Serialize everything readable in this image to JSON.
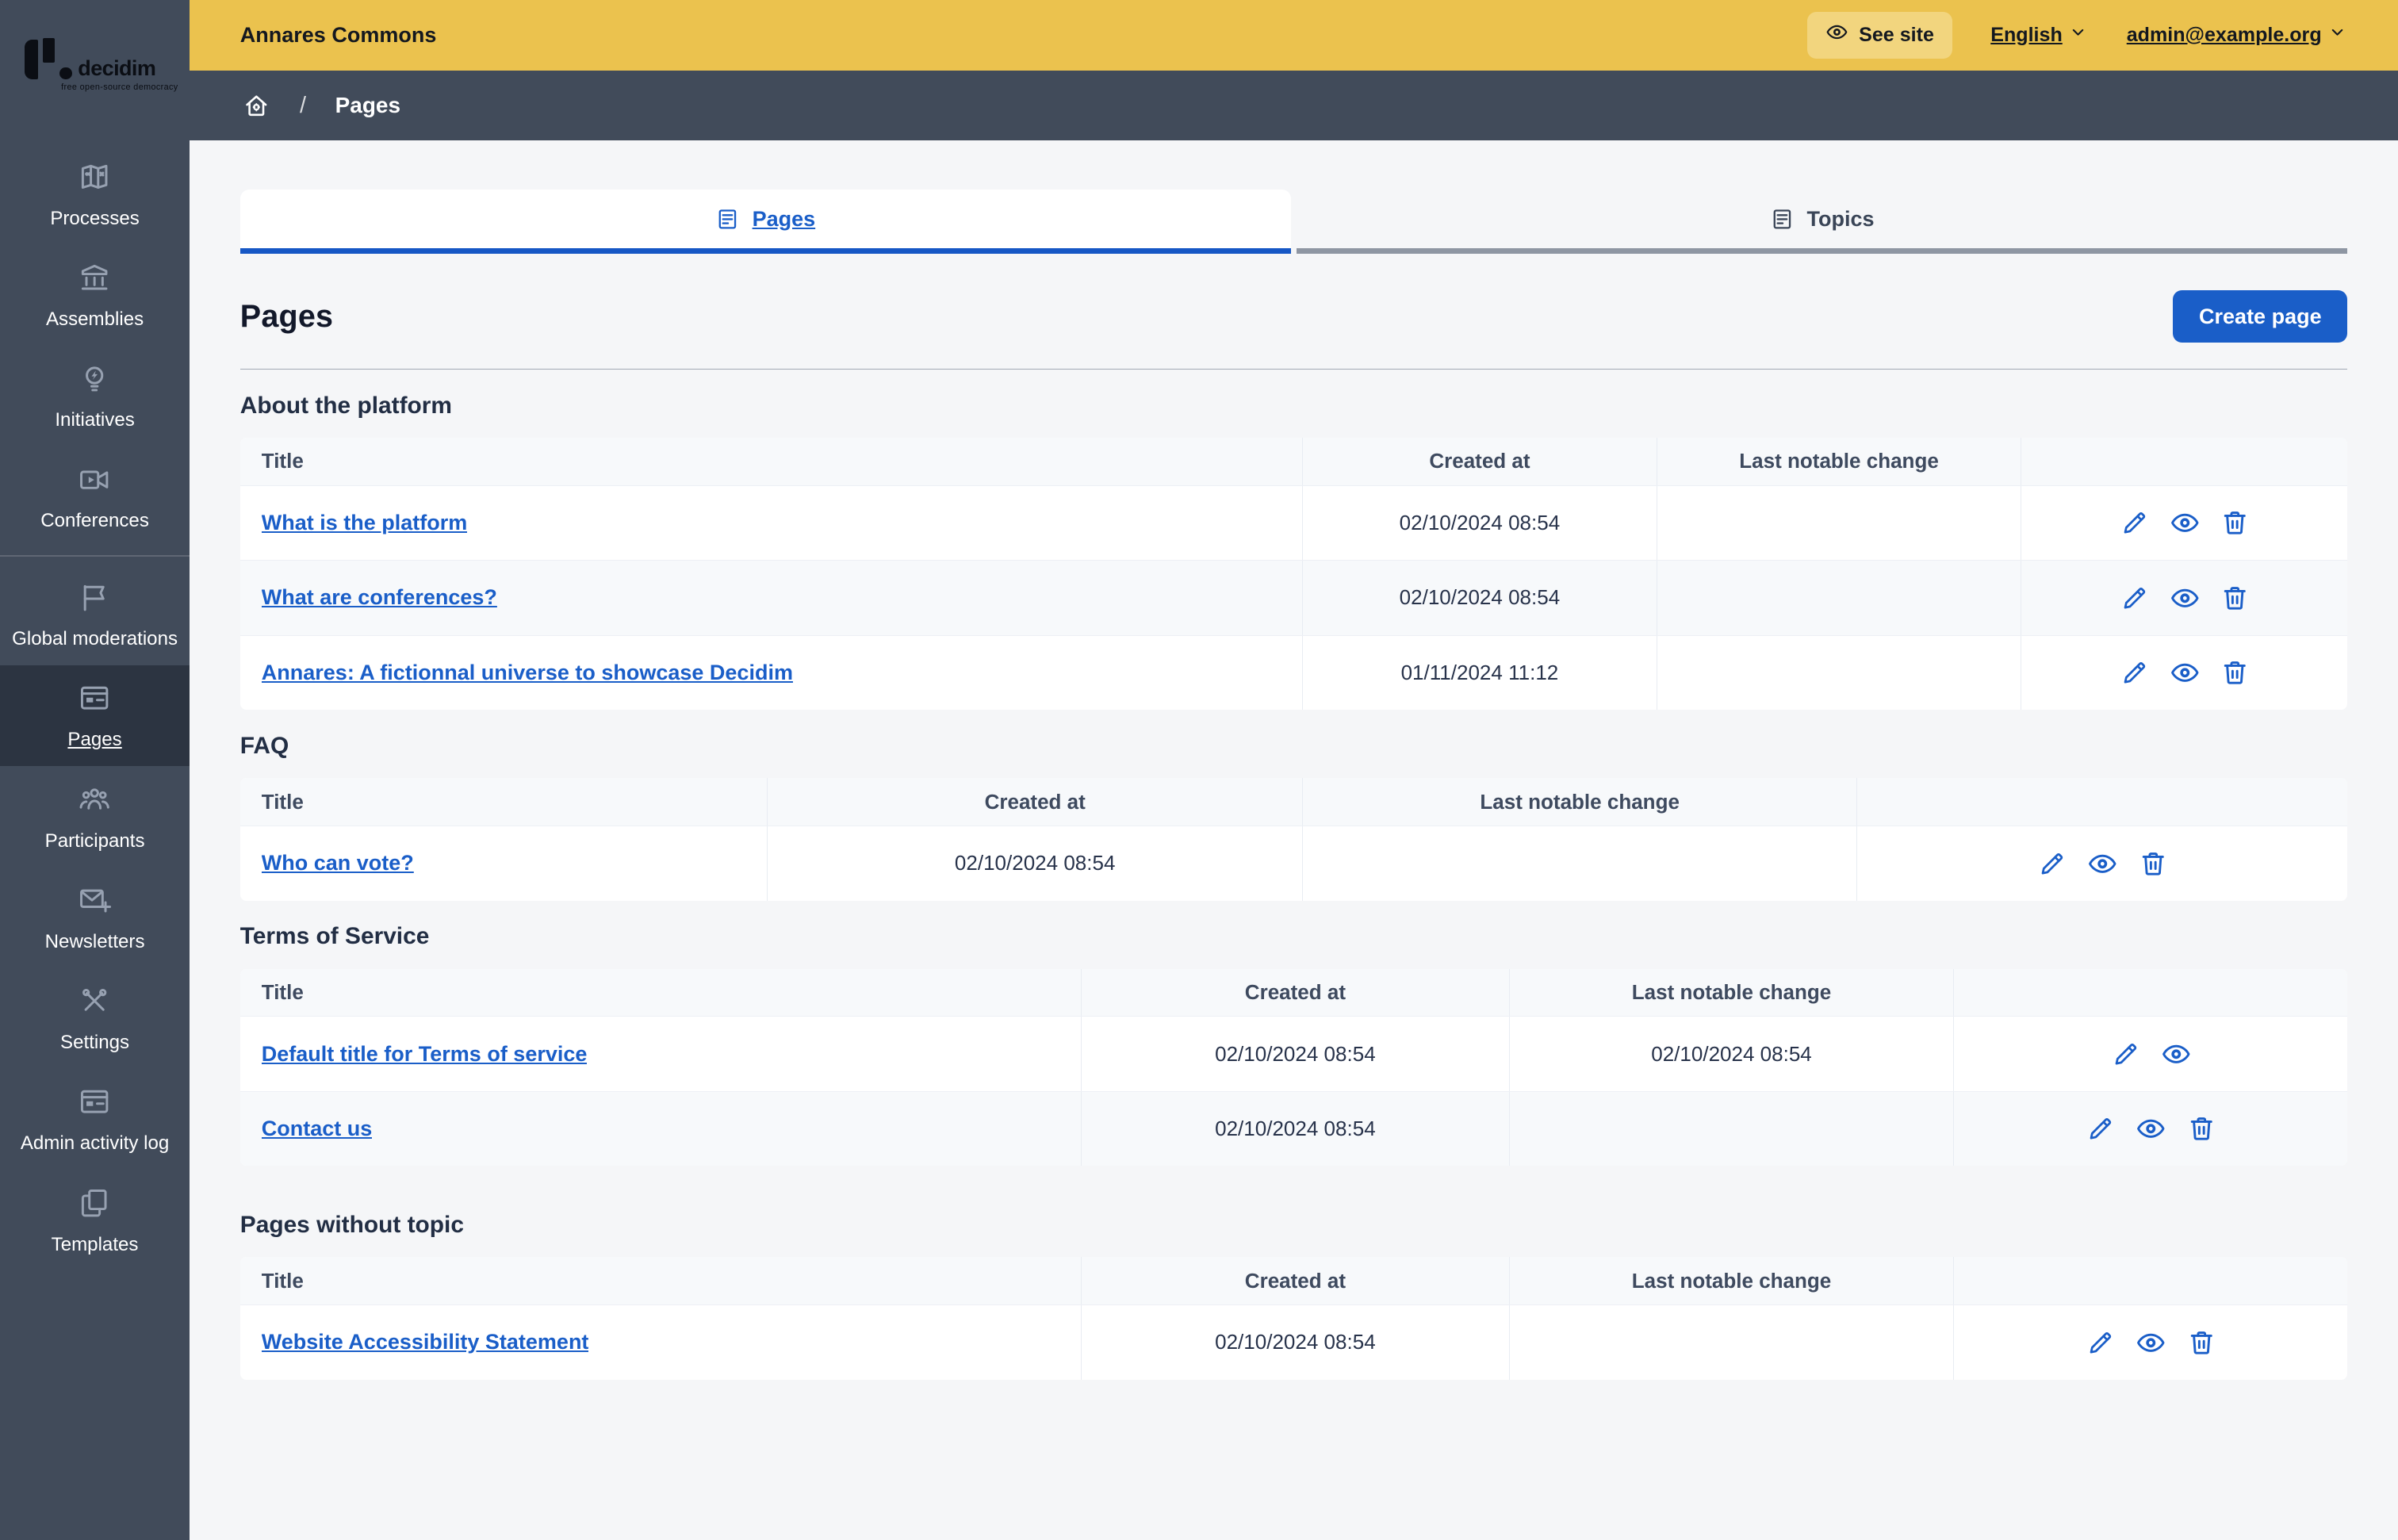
{
  "branding": {
    "logo_text": "decidim",
    "logo_tagline": "free open-source democracy"
  },
  "topbar": {
    "title": "Annares Commons",
    "see_site_label": "See site",
    "language_label": "English",
    "user_email": "admin@example.org"
  },
  "breadcrumb": {
    "current": "Pages"
  },
  "sidebar": {
    "groups": [
      {
        "items": [
          {
            "label": "Processes",
            "icon": "map-icon"
          },
          {
            "label": "Assemblies",
            "icon": "bank-icon"
          },
          {
            "label": "Initiatives",
            "icon": "lightbulb-flash-icon"
          },
          {
            "label": "Conferences",
            "icon": "video-camera-icon"
          }
        ]
      },
      {
        "items": [
          {
            "label": "Global moderations",
            "icon": "flag-icon"
          },
          {
            "label": "Pages",
            "icon": "window-icon",
            "active": true
          },
          {
            "label": "Participants",
            "icon": "team-icon"
          },
          {
            "label": "Newsletters",
            "icon": "mail-add-icon"
          },
          {
            "label": "Settings",
            "icon": "tools-icon"
          },
          {
            "label": "Admin activity log",
            "icon": "window-icon"
          },
          {
            "label": "Templates",
            "icon": "file-copy-icon"
          }
        ]
      }
    ]
  },
  "tabs": [
    {
      "label": "Pages",
      "icon": "article-icon",
      "active": true
    },
    {
      "label": "Topics",
      "icon": "article-icon",
      "active": false
    }
  ],
  "page": {
    "title": "Pages",
    "create_button_label": "Create page"
  },
  "columns": {
    "title": "Title",
    "created_at": "Created at",
    "last_change": "Last notable change"
  },
  "sections": [
    {
      "title": "About the platform",
      "layout": "about",
      "rows": [
        {
          "title": "What is the platform",
          "created_at": "02/10/2024 08:54",
          "last_change": "",
          "actions": [
            "edit",
            "preview",
            "delete"
          ]
        },
        {
          "title": "What are conferences?",
          "created_at": "02/10/2024 08:54",
          "last_change": "",
          "actions": [
            "edit",
            "preview",
            "delete"
          ]
        },
        {
          "title": "Annares: A fictionnal universe to showcase Decidim",
          "created_at": "01/11/2024 11:12",
          "last_change": "",
          "actions": [
            "edit",
            "preview",
            "delete"
          ]
        }
      ]
    },
    {
      "title": "FAQ",
      "layout": "faq",
      "rows": [
        {
          "title": "Who can vote?",
          "created_at": "02/10/2024 08:54",
          "last_change": "",
          "actions": [
            "edit",
            "preview",
            "delete"
          ]
        }
      ]
    },
    {
      "title": "Terms of Service",
      "layout": "tos",
      "rows": [
        {
          "title": "Default title for Terms of service",
          "created_at": "02/10/2024 08:54",
          "last_change": "02/10/2024 08:54",
          "actions": [
            "edit",
            "preview"
          ]
        },
        {
          "title": "Contact us",
          "created_at": "02/10/2024 08:54",
          "last_change": "",
          "actions": [
            "edit",
            "preview",
            "delete"
          ]
        }
      ]
    },
    {
      "title": "Pages without topic",
      "layout": "tos",
      "gap": "lg",
      "rows": [
        {
          "title": "Website Accessibility Statement",
          "created_at": "02/10/2024 08:54",
          "last_change": "",
          "actions": [
            "edit",
            "preview",
            "delete"
          ]
        }
      ]
    }
  ],
  "colors": {
    "accent_blue": "#1a5ec8",
    "topbar_yellow": "#ebc24e",
    "sidebar_slate": "#414b5a",
    "sidebar_active": "#2c3441",
    "page_background": "#f5f6f8",
    "row_alt": "#f7f9fb"
  }
}
